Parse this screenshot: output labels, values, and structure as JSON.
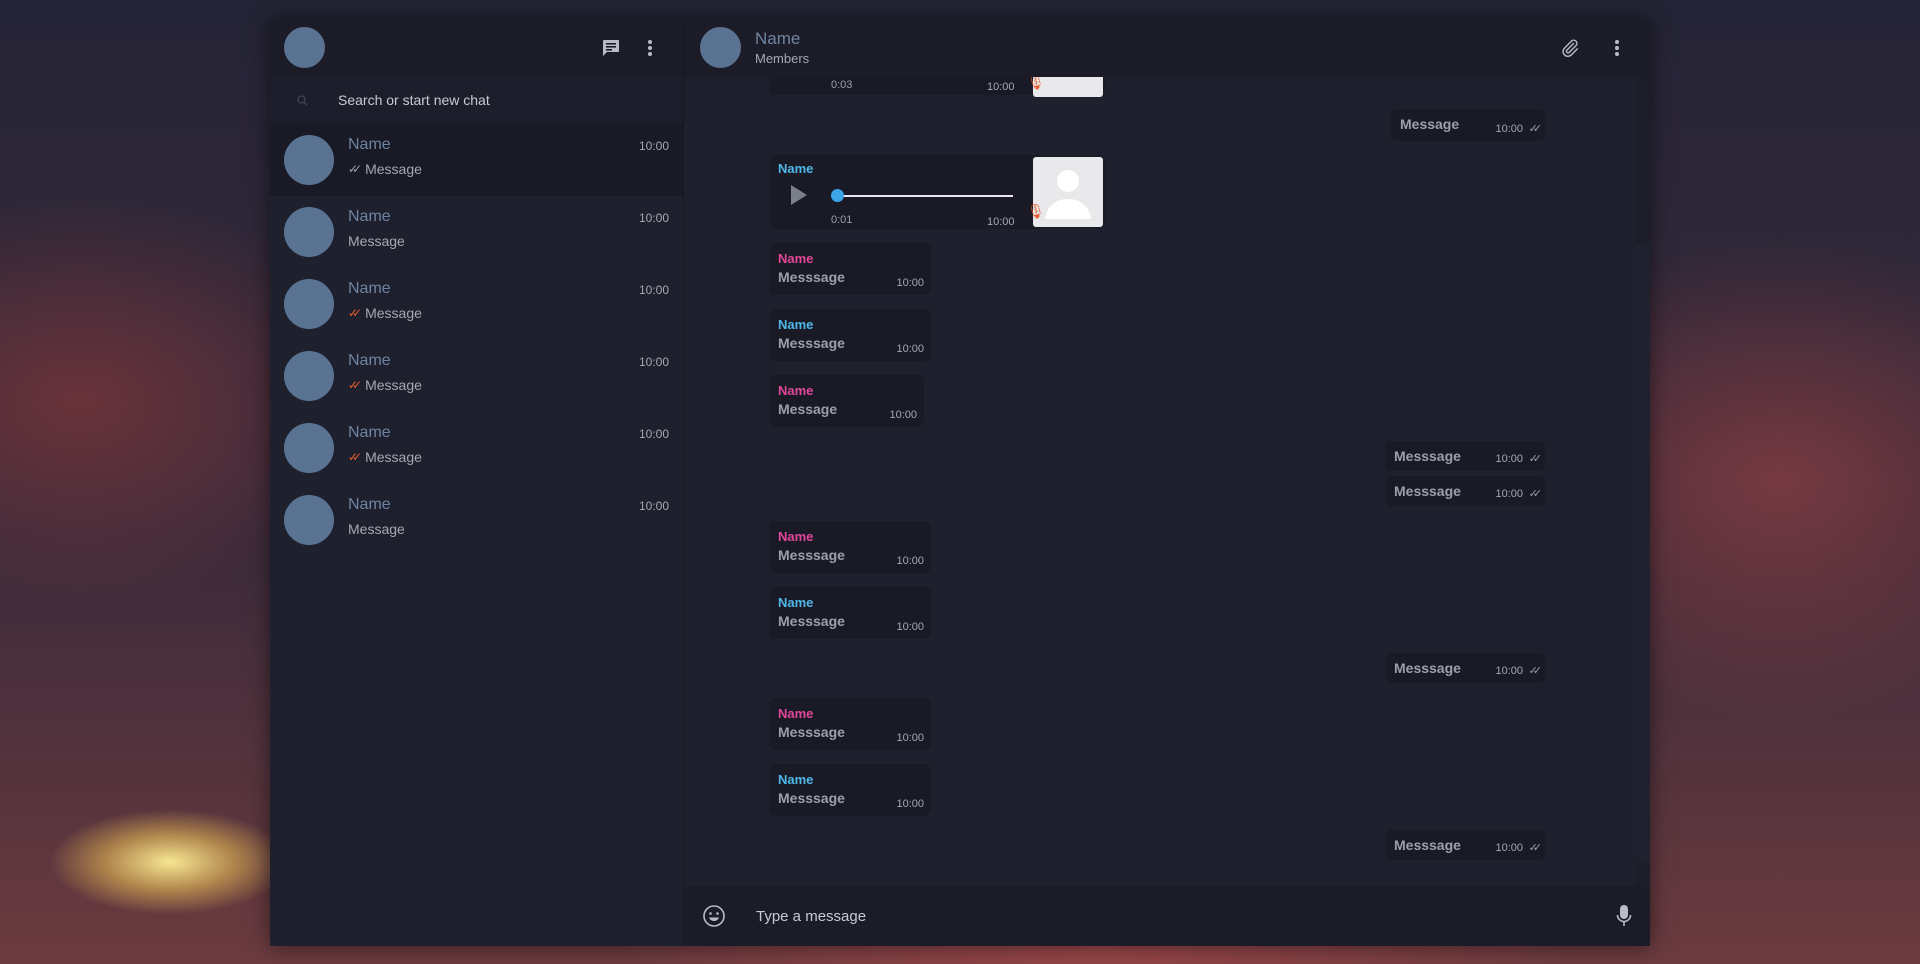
{
  "sidebar": {
    "search_placeholder": "Search or start new chat",
    "chats": [
      {
        "name": "Name",
        "time": "10:00",
        "message": "Message",
        "status": "sent"
      },
      {
        "name": "Name",
        "time": "10:00",
        "message": "Message",
        "status": "none"
      },
      {
        "name": "Name",
        "time": "10:00",
        "message": "Message",
        "status": "read"
      },
      {
        "name": "Name",
        "time": "10:00",
        "message": "Message",
        "status": "read"
      },
      {
        "name": "Name",
        "time": "10:00",
        "message": "Message",
        "status": "read"
      },
      {
        "name": "Name",
        "time": "10:00",
        "message": "Message",
        "status": "none"
      }
    ]
  },
  "header": {
    "name": "Name",
    "subtitle": "Members"
  },
  "voice_messages": [
    {
      "duration": "0:03",
      "time": "10:00"
    },
    {
      "sender": "Name",
      "duration": "0:01",
      "time": "10:00"
    }
  ],
  "messages": [
    {
      "dir": "out",
      "text": "Message",
      "time": "10:00"
    },
    {
      "dir": "in",
      "sender": "Name",
      "sender_color": "pink",
      "text": "Messsage",
      "time": "10:00"
    },
    {
      "dir": "in",
      "sender": "Name",
      "sender_color": "blue",
      "text": "Messsage",
      "time": "10:00"
    },
    {
      "dir": "in",
      "sender": "Name",
      "sender_color": "pink",
      "text": "Message",
      "time": "10:00"
    },
    {
      "dir": "out",
      "text": "Messsage",
      "time": "10:00"
    },
    {
      "dir": "out",
      "text": "Messsage",
      "time": "10:00"
    },
    {
      "dir": "in",
      "sender": "Name",
      "sender_color": "pink",
      "text": "Messsage",
      "time": "10:00"
    },
    {
      "dir": "in",
      "sender": "Name",
      "sender_color": "blue",
      "text": "Messsage",
      "time": "10:00"
    },
    {
      "dir": "out",
      "text": "Messsage",
      "time": "10:00"
    },
    {
      "dir": "in",
      "sender": "Name",
      "sender_color": "pink",
      "text": "Messsage",
      "time": "10:00"
    },
    {
      "dir": "in",
      "sender": "Name",
      "sender_color": "blue",
      "text": "Messsage",
      "time": "10:00"
    },
    {
      "dir": "out",
      "text": "Messsage",
      "time": "10:00"
    }
  ],
  "composer": {
    "placeholder": "Type a message"
  },
  "colors": {
    "pink": "#e3479a",
    "blue": "#4fb8e8",
    "read_tick": "#e35a2a",
    "accent": "#3aa6e8"
  },
  "icons": [
    "new-chat-icon",
    "menu-dots-icon",
    "search-icon",
    "paperclip-icon",
    "emoji-icon",
    "microphone-icon",
    "play-icon"
  ]
}
